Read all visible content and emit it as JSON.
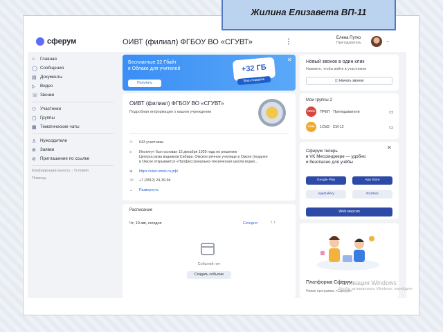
{
  "slide_caption": "Жилина Елизавета ВП-11",
  "app": {
    "logo_text": "сферум",
    "org_title": "ОИВТ (филиал) ФГБОУ ВО «СГУВТ»",
    "more_icon": "⋮",
    "user": {
      "name": "Елена Путко",
      "role": "Преподаватель"
    }
  },
  "sidebar": {
    "primary": [
      {
        "label": "Главная",
        "icon": "home-icon",
        "glyph": "⌂"
      },
      {
        "label": "Сообщения",
        "icon": "chat-icon",
        "glyph": "◯"
      },
      {
        "label": "Документы",
        "icon": "document-icon",
        "glyph": "▤"
      },
      {
        "label": "Видео",
        "icon": "video-icon",
        "glyph": "▷"
      },
      {
        "label": "Звонки",
        "icon": "phone-icon",
        "glyph": "☏"
      }
    ],
    "secondary": [
      {
        "label": "Участники",
        "icon": "users-icon",
        "glyph": "⚇"
      },
      {
        "label": "Группы",
        "icon": "groups-icon",
        "glyph": "▢"
      },
      {
        "label": "Тематические чаты",
        "icon": "topics-icon",
        "glyph": "▦"
      }
    ],
    "tertiary": [
      {
        "label": "Нужсодители",
        "icon": "person-icon",
        "glyph": "♙"
      },
      {
        "label": "Заявки",
        "icon": "requests-icon",
        "glyph": "⊕"
      },
      {
        "label": "Приглашение по ссылке",
        "icon": "link-icon",
        "glyph": "⊘"
      }
    ],
    "footer": [
      "Конфиденциальность · Условия",
      "Помощь"
    ]
  },
  "promo": {
    "line1": "Бесплатные 32 Гбайт",
    "line2": "в Облаке для учителей",
    "button": "Получить",
    "badge": "+32 ГБ",
    "gift": "Ваш подарок",
    "close": "✕"
  },
  "org_card": {
    "name": "ОИВТ (филиал) ФГБОУ ВО «СГУВТ»",
    "subtitle": "Подробная информация о вашем учреждении",
    "members": "643 участника",
    "history1": "Институт был основан 15 декабря 1920 года по решению",
    "history2": "Центросоюза водников Сибири. Омское речное училище в Омске (позднее",
    "history3": "в Омске открывается «Профессионально-техническая школа водно...",
    "site": "https://oiwt-omsk.ru.рф/",
    "phone": "+7 (3812) 24-39-94",
    "more": "Развернуть"
  },
  "feed": {
    "title": "Расписание",
    "date": "Чт, 10 авг, сегодня",
    "today": "Сегодня",
    "arrows": "‹   ›",
    "empty": "Событий нет",
    "create": "Создать событие"
  },
  "call": {
    "title": "Новый звонок в один клик",
    "subtitle": "Нажмите, чтобы войти в участников",
    "button": "Начать звонок"
  },
  "groups": {
    "title": "Мои группы 2",
    "items": [
      {
        "badge": "ПРЕП",
        "label": "ПРЕП · Преподаватели",
        "color": "#d9453f"
      },
      {
        "badge": "1СМ2",
        "label": "1СМ2 · СМ-12",
        "color": "#f0a92e"
      }
    ]
  },
  "vk": {
    "line1": "Сферум теперь",
    "line2": "в VK Мессенджере — удобно",
    "line3": "и безопасно для учёбы",
    "stores": [
      "Google Play",
      "App Store",
      "AppGallery",
      "RuStore"
    ],
    "web": "Web версия",
    "close": "✕"
  },
  "platform": {
    "title": "Платформа Сферум",
    "sub1": "Новая программа «Сферум»",
    "sub2": "Активация Windows"
  },
  "watermark": {
    "title": "Активация Windows",
    "sub": "Чтобы активировать Windows, перейдите"
  },
  "colors": {
    "accent": "#2d4aa6",
    "promo": "#3a8ef5",
    "frame_border": "#4f7bc4"
  }
}
